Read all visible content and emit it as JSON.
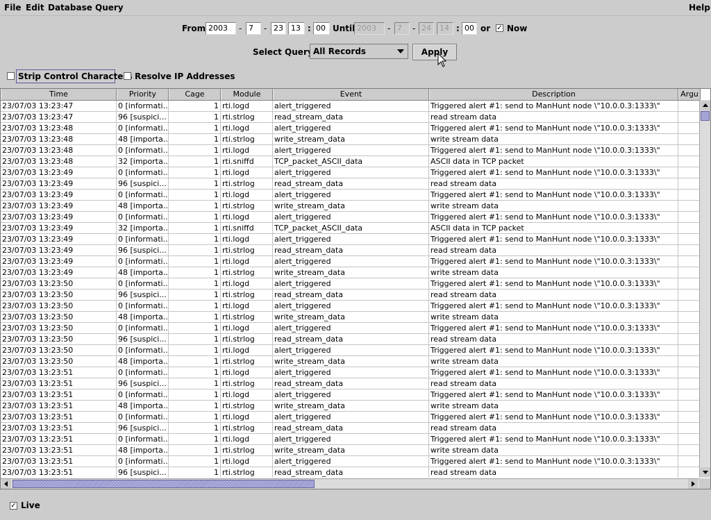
{
  "menu": {
    "file": "File",
    "edit": "Edit",
    "database": "Database",
    "query": "Query",
    "help": "Help"
  },
  "date_range": {
    "from_label": "From",
    "from": {
      "year": "2003",
      "month": "7",
      "day": "23",
      "hour": "13",
      "minute": "00"
    },
    "until_label": "Until",
    "until": {
      "year": "2003",
      "month": "7",
      "day": "24",
      "hour": "14",
      "minute": "00"
    },
    "or_label": "or",
    "now_label": "Now",
    "now_checked": "✓",
    "dash": "-",
    "colon": ":"
  },
  "query": {
    "label": "Select Query:",
    "selected": "All Records",
    "apply_label": "Apply"
  },
  "options": {
    "strip_label": "Strip Control Characters",
    "resolve_label": "Resolve IP Addresses"
  },
  "table": {
    "columns": [
      "Time",
      "Priority",
      "Cage",
      "Module",
      "Event",
      "Description",
      "Argu"
    ],
    "rows": [
      [
        "23/07/03 13:23:47",
        "0 [informati...",
        "1",
        "rti.logd",
        "alert_triggered",
        "Triggered alert #1: send to ManHunt node \\\"10.0.0.3:1333\\\"",
        ""
      ],
      [
        "23/07/03 13:23:47",
        "96 [suspici...",
        "1",
        "rti.strlog",
        "read_stream_data",
        "read stream data",
        ""
      ],
      [
        "23/07/03 13:23:48",
        "0 [informati...",
        "1",
        "rti.logd",
        "alert_triggered",
        "Triggered alert #1: send to ManHunt node \\\"10.0.0.3:1333\\\"",
        ""
      ],
      [
        "23/07/03 13:23:48",
        "48 [importa...",
        "1",
        "rti.strlog",
        "write_stream_data",
        "write stream data",
        ""
      ],
      [
        "23/07/03 13:23:48",
        "0 [informati...",
        "1",
        "rti.logd",
        "alert_triggered",
        "Triggered alert #1: send to ManHunt node \\\"10.0.0.3:1333\\\"",
        ""
      ],
      [
        "23/07/03 13:23:48",
        "32 [importa...",
        "1",
        "rti.sniffd",
        "TCP_packet_ASCII_data",
        "ASCII data in TCP packet",
        ""
      ],
      [
        "23/07/03 13:23:49",
        "0 [informati...",
        "1",
        "rti.logd",
        "alert_triggered",
        "Triggered alert #1: send to ManHunt node \\\"10.0.0.3:1333\\\"",
        ""
      ],
      [
        "23/07/03 13:23:49",
        "96 [suspici...",
        "1",
        "rti.strlog",
        "read_stream_data",
        "read stream data",
        ""
      ],
      [
        "23/07/03 13:23:49",
        "0 [informati...",
        "1",
        "rti.logd",
        "alert_triggered",
        "Triggered alert #1: send to ManHunt node \\\"10.0.0.3:1333\\\"",
        ""
      ],
      [
        "23/07/03 13:23:49",
        "48 [importa...",
        "1",
        "rti.strlog",
        "write_stream_data",
        "write stream data",
        ""
      ],
      [
        "23/07/03 13:23:49",
        "0 [informati...",
        "1",
        "rti.logd",
        "alert_triggered",
        "Triggered alert #1: send to ManHunt node \\\"10.0.0.3:1333\\\"",
        ""
      ],
      [
        "23/07/03 13:23:49",
        "32 [importa...",
        "1",
        "rti.sniffd",
        "TCP_packet_ASCII_data",
        "ASCII data in TCP packet",
        ""
      ],
      [
        "23/07/03 13:23:49",
        "0 [informati...",
        "1",
        "rti.logd",
        "alert_triggered",
        "Triggered alert #1: send to ManHunt node \\\"10.0.0.3:1333\\\"",
        ""
      ],
      [
        "23/07/03 13:23:49",
        "96 [suspici...",
        "1",
        "rti.strlog",
        "read_stream_data",
        "read stream data",
        ""
      ],
      [
        "23/07/03 13:23:49",
        "0 [informati...",
        "1",
        "rti.logd",
        "alert_triggered",
        "Triggered alert #1: send to ManHunt node \\\"10.0.0.3:1333\\\"",
        ""
      ],
      [
        "23/07/03 13:23:49",
        "48 [importa...",
        "1",
        "rti.strlog",
        "write_stream_data",
        "write stream data",
        ""
      ],
      [
        "23/07/03 13:23:50",
        "0 [informati...",
        "1",
        "rti.logd",
        "alert_triggered",
        "Triggered alert #1: send to ManHunt node \\\"10.0.0.3:1333\\\"",
        ""
      ],
      [
        "23/07/03 13:23:50",
        "96 [suspici...",
        "1",
        "rti.strlog",
        "read_stream_data",
        "read stream data",
        ""
      ],
      [
        "23/07/03 13:23:50",
        "0 [informati...",
        "1",
        "rti.logd",
        "alert_triggered",
        "Triggered alert #1: send to ManHunt node \\\"10.0.0.3:1333\\\"",
        ""
      ],
      [
        "23/07/03 13:23:50",
        "48 [importa...",
        "1",
        "rti.strlog",
        "write_stream_data",
        "write stream data",
        ""
      ],
      [
        "23/07/03 13:23:50",
        "0 [informati...",
        "1",
        "rti.logd",
        "alert_triggered",
        "Triggered alert #1: send to ManHunt node \\\"10.0.0.3:1333\\\"",
        ""
      ],
      [
        "23/07/03 13:23:50",
        "96 [suspici...",
        "1",
        "rti.strlog",
        "read_stream_data",
        "read stream data",
        ""
      ],
      [
        "23/07/03 13:23:50",
        "0 [informati...",
        "1",
        "rti.logd",
        "alert_triggered",
        "Triggered alert #1: send to ManHunt node \\\"10.0.0.3:1333\\\"",
        ""
      ],
      [
        "23/07/03 13:23:50",
        "48 [importa...",
        "1",
        "rti.strlog",
        "write_stream_data",
        "write stream data",
        ""
      ],
      [
        "23/07/03 13:23:51",
        "0 [informati...",
        "1",
        "rti.logd",
        "alert_triggered",
        "Triggered alert #1: send to ManHunt node \\\"10.0.0.3:1333\\\"",
        ""
      ],
      [
        "23/07/03 13:23:51",
        "96 [suspici...",
        "1",
        "rti.strlog",
        "read_stream_data",
        "read stream data",
        ""
      ],
      [
        "23/07/03 13:23:51",
        "0 [informati...",
        "1",
        "rti.logd",
        "alert_triggered",
        "Triggered alert #1: send to ManHunt node \\\"10.0.0.3:1333\\\"",
        ""
      ],
      [
        "23/07/03 13:23:51",
        "48 [importa...",
        "1",
        "rti.strlog",
        "write_stream_data",
        "write stream data",
        ""
      ],
      [
        "23/07/03 13:23:51",
        "0 [informati...",
        "1",
        "rti.logd",
        "alert_triggered",
        "Triggered alert #1: send to ManHunt node \\\"10.0.0.3:1333\\\"",
        ""
      ],
      [
        "23/07/03 13:23:51",
        "96 [suspici...",
        "1",
        "rti.strlog",
        "read_stream_data",
        "read stream data",
        ""
      ],
      [
        "23/07/03 13:23:51",
        "0 [informati...",
        "1",
        "rti.logd",
        "alert_triggered",
        "Triggered alert #1: send to ManHunt node \\\"10.0.0.3:1333\\\"",
        ""
      ],
      [
        "23/07/03 13:23:51",
        "48 [importa...",
        "1",
        "rti.strlog",
        "write_stream_data",
        "write stream data",
        ""
      ],
      [
        "23/07/03 13:23:51",
        "0 [informati...",
        "1",
        "rti.logd",
        "alert_triggered",
        "Triggered alert #1: send to ManHunt node \\\"10.0.0.3:1333\\\"",
        ""
      ],
      [
        "23/07/03 13:23:51",
        "96 [suspici...",
        "1",
        "rti.strlog",
        "read_stream_data",
        "read stream data",
        ""
      ]
    ]
  },
  "live": {
    "label": "Live",
    "checked": "✓"
  },
  "colors": {
    "background": "#cccccc",
    "scroll_thumb": "#9999cc"
  },
  "icons": [
    "checkbox-checked-icon",
    "combo-arrow-icon",
    "mouse-cursor-icon",
    "scroll-up-icon",
    "scroll-down-icon",
    "scroll-left-icon",
    "scroll-right-icon"
  ]
}
